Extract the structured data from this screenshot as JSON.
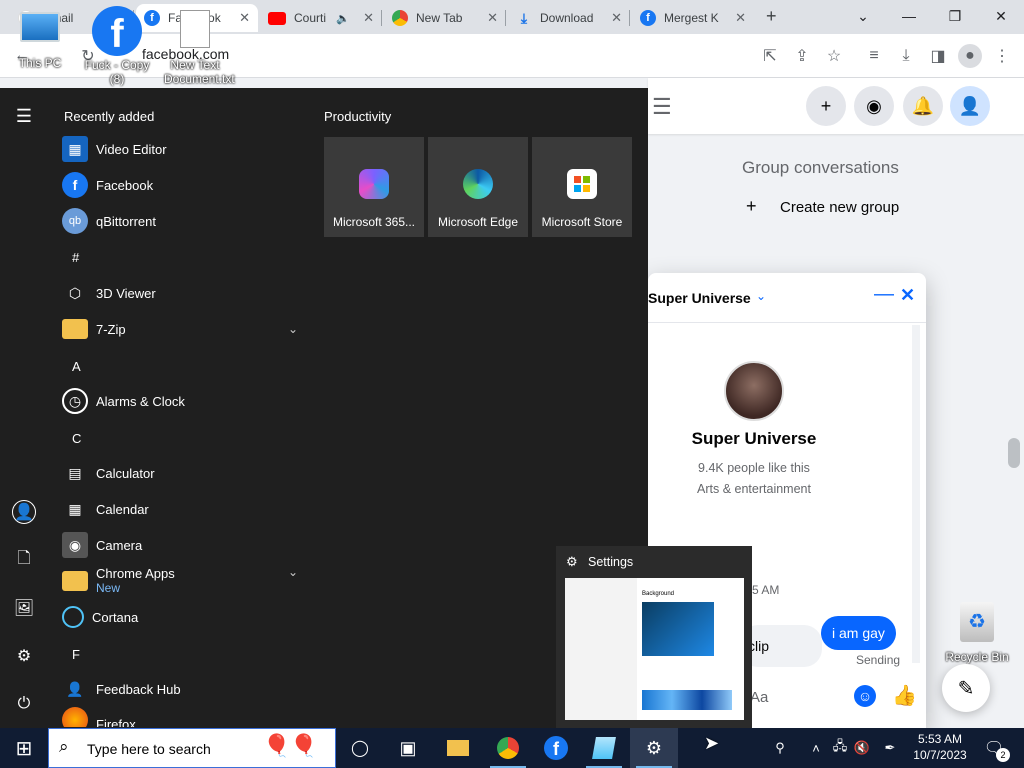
{
  "browser": {
    "tabs": [
      {
        "title": "Gmail",
        "icon": "gmail-icon"
      },
      {
        "title": "Facebook",
        "icon": "facebook-icon",
        "active": true
      },
      {
        "title": "Courti",
        "icon": "youtube-icon",
        "muted_audio": true
      },
      {
        "title": "New Tab",
        "icon": "chrome-icon"
      },
      {
        "title": "Download",
        "icon": "download-icon"
      },
      {
        "title": "Mergest K",
        "icon": "facebook-icon"
      }
    ],
    "new_tab_symbol": "+",
    "address_text": "facebook.com",
    "window_controls": {
      "dropdown": "⌄",
      "minimize": "—",
      "restore": "❐",
      "close": "✕"
    }
  },
  "desktop": {
    "icons": [
      {
        "label": "This PC",
        "icon": "computer-icon"
      },
      {
        "label": "Fuck - Copy (8)",
        "icon": "facebook-shortcut-icon"
      },
      {
        "label": "New Text Document.txt",
        "icon": "text-document-icon"
      },
      {
        "label": "Recycle Bin",
        "icon": "recycle-bin-icon"
      }
    ]
  },
  "facebook": {
    "group_conversations_title": "Group conversations",
    "create_group_label": "Create new group",
    "chat": {
      "page_name": "Super Universe",
      "header_name": "Super Universe",
      "likes": "9.4K people like this",
      "category": "Arts & entertainment",
      "timestamp_partial": "5 AM",
      "received_partial": "clip",
      "sent_message": "i am gay",
      "send_status": "Sending",
      "composer_placeholder": "Aa"
    },
    "accent": "#0866ff"
  },
  "start_menu": {
    "recently_added_title": "Recently added",
    "productivity_title": "Productivity",
    "apps": [
      {
        "label": "Video Editor",
        "icon": "video-editor-icon"
      },
      {
        "label": "Facebook",
        "icon": "facebook-icon"
      },
      {
        "label": "qBittorrent",
        "icon": "qbittorrent-icon"
      },
      {
        "label": "#",
        "header": true
      },
      {
        "label": "3D Viewer",
        "icon": "cube-icon"
      },
      {
        "label": "7-Zip",
        "icon": "folder-icon",
        "expandable": true
      },
      {
        "label": "A",
        "header": true
      },
      {
        "label": "Alarms & Clock",
        "icon": "clock-icon"
      },
      {
        "label": "C",
        "header": true
      },
      {
        "label": "Calculator",
        "icon": "calculator-icon"
      },
      {
        "label": "Calendar",
        "icon": "calendar-icon"
      },
      {
        "label": "Camera",
        "icon": "camera-icon"
      },
      {
        "label": "Chrome Apps",
        "sublabel": "New",
        "icon": "folder-icon",
        "expandable": true
      },
      {
        "label": "Cortana",
        "icon": "cortana-icon"
      },
      {
        "label": "F",
        "header": true
      },
      {
        "label": "Feedback Hub",
        "icon": "feedback-icon"
      },
      {
        "label": "Firefox",
        "icon": "firefox-icon"
      }
    ],
    "tiles": [
      {
        "label": "Microsoft 365...",
        "icon": "m365-icon"
      },
      {
        "label": "Microsoft Edge",
        "icon": "edge-icon"
      },
      {
        "label": "Microsoft Store",
        "icon": "store-icon"
      }
    ]
  },
  "settings_preview": {
    "title": "Settings",
    "inner_heading": "Background"
  },
  "taskbar": {
    "search_placeholder": "Type here to search",
    "time": "5:53 AM",
    "date": "10/7/2023",
    "notification_count": "2"
  }
}
